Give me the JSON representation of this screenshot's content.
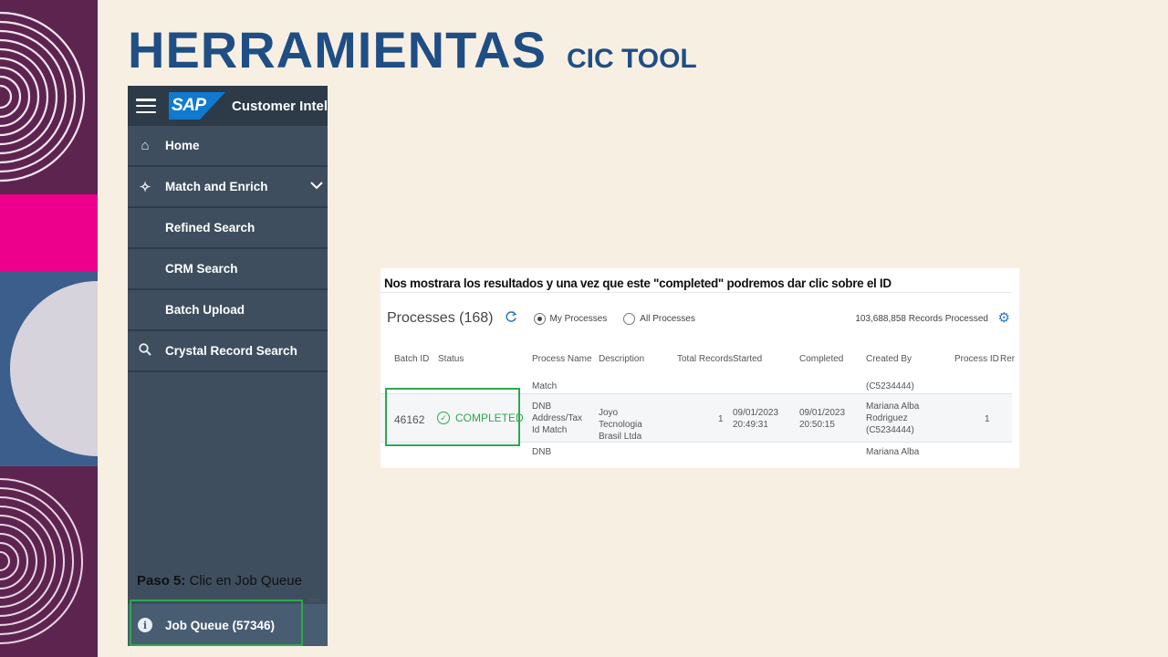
{
  "slide": {
    "title_main": "HERRAMIENTAS",
    "title_sub": "CIC TOOL",
    "step_label": "Paso 5:",
    "step_text": " Clic en Job Queue",
    "caption": "Nos mostrara los resultados y una vez que este \"completed\" podremos dar clic sobre el ID"
  },
  "colors": {
    "accent_blue": "#1f4e85",
    "sidebar_bg": "#3e4e5e",
    "highlight_green": "#2ea84f"
  },
  "sidebar": {
    "logo_text": "SAP",
    "app_title": "Customer Intel",
    "items": [
      {
        "label": "Home",
        "icon": "home-icon"
      },
      {
        "label": "Match and Enrich",
        "icon": "magic-wand-icon"
      },
      {
        "label": "Refined Search"
      },
      {
        "label": "CRM Search"
      },
      {
        "label": "Batch Upload"
      },
      {
        "label": "Crystal Record Search",
        "icon": "search-icon"
      }
    ],
    "job_queue": "Job Queue (57346)"
  },
  "processes": {
    "title": "Processes (168)",
    "my_processes": "My Processes",
    "all_processes": "All Processes",
    "records_processed": "103,688,858 Records Processed",
    "columns": [
      "Batch ID",
      "Status",
      "Process Name",
      "Description",
      "Total Records",
      "Started",
      "Completed",
      "Created By",
      "Process ID",
      "Rer"
    ],
    "prev_row": {
      "process_name": "Match",
      "created_by": "(C5234444)"
    },
    "row": {
      "batch_id": "46162",
      "status": "COMPLETED",
      "process_name": "DNB Address/Tax Id Match",
      "description": "Joyo Tecnologia Brasil Ltda",
      "total_records": "1",
      "started": "09/01/2023 20:49:31",
      "completed": "09/01/2023 20:50:15",
      "created_by": "Mariana Alba Rodriguez (C5234444)",
      "process_id": "1"
    },
    "next_row": {
      "process_name": "DNB",
      "created_by": "Mariana Alba"
    }
  }
}
